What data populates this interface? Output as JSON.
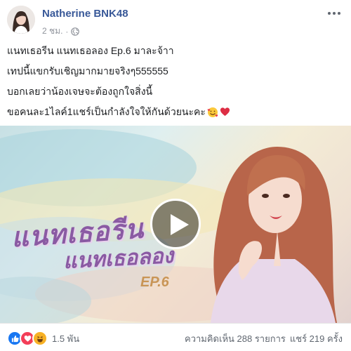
{
  "header": {
    "author": "Natherine BNK48",
    "timestamp": "2 ชม.",
    "separator": "·",
    "privacy_icon": "globe-icon"
  },
  "post": {
    "lines": [
      "แนทเธอรีน แนทเธอลอง Ep.6 มาละจ้าา",
      "เทปนี้แขกรับเชิญมากมายจริงๆ555555",
      "บอกเลยว่าน้องเจษจะต้องถูกใจสิ่งนี้",
      "ขอคนละ1ไลค์1แชร์เป็นกำลังใจให้กันด้วยนะคะ"
    ],
    "emojis": [
      "smiling-face-with-hearts",
      "red-heart"
    ]
  },
  "video": {
    "title_line1": "แนทเธอรีน",
    "title_line2": "แนทเธอลอง",
    "episode": "EP.6",
    "play_icon": "play-icon"
  },
  "footer": {
    "reactions": [
      "like",
      "love",
      "haha"
    ],
    "reaction_count": "1.5 พัน",
    "comments": "ความคิดเห็น 288 รายการ",
    "shares": "แชร์ 219 ครั้ง"
  },
  "colors": {
    "author": "#385898",
    "meta": "#90949c",
    "like": "#1877f2",
    "love": "#f33e58",
    "haha": "#f7b125"
  }
}
